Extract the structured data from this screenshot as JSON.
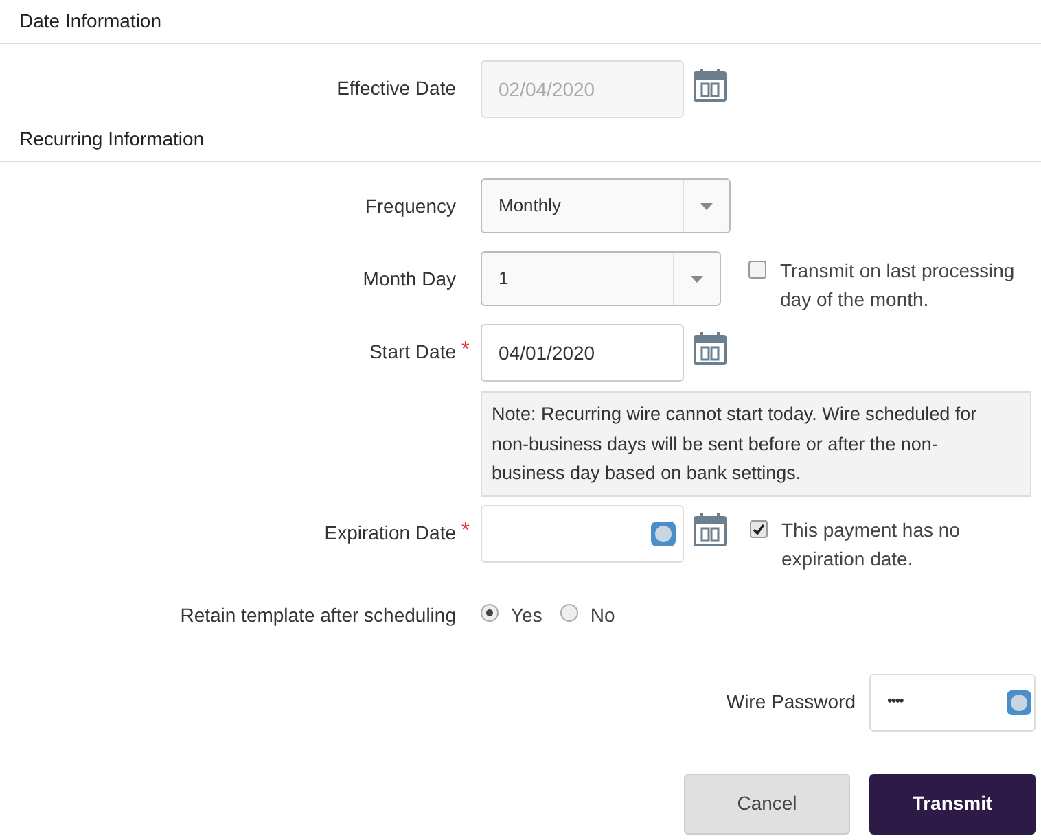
{
  "date_section": {
    "title": "Date Information",
    "effective_date": {
      "label": "Effective Date",
      "value": "02/04/2020",
      "disabled": true
    }
  },
  "recurring_section": {
    "title": "Recurring Information",
    "frequency": {
      "label": "Frequency",
      "value": "Monthly"
    },
    "month_day": {
      "label": "Month Day",
      "value": "1",
      "last_day_checkbox": {
        "label": "Transmit on last processing day of the month.",
        "checked": false
      }
    },
    "start_date": {
      "label": "Start Date",
      "required_mark": "*",
      "value": "04/01/2020",
      "note": "Note: Recurring wire cannot start today. Wire scheduled for non-business days will be sent before or after the non-business day based on bank settings."
    },
    "expiration_date": {
      "label": "Expiration Date",
      "required_mark": "*",
      "no_expiration_checkbox": {
        "label": "This payment has no expiration date.",
        "checked": true
      }
    },
    "retain_template": {
      "label": "Retain template after scheduling",
      "options": [
        {
          "label": "Yes",
          "selected": true
        },
        {
          "label": "No",
          "selected": false
        }
      ]
    }
  },
  "wire_password": {
    "label": "Wire Password",
    "value": "••••"
  },
  "buttons": [
    {
      "label": "Cancel",
      "kind": "secondary"
    },
    {
      "label": "Transmit",
      "kind": "primary"
    }
  ]
}
